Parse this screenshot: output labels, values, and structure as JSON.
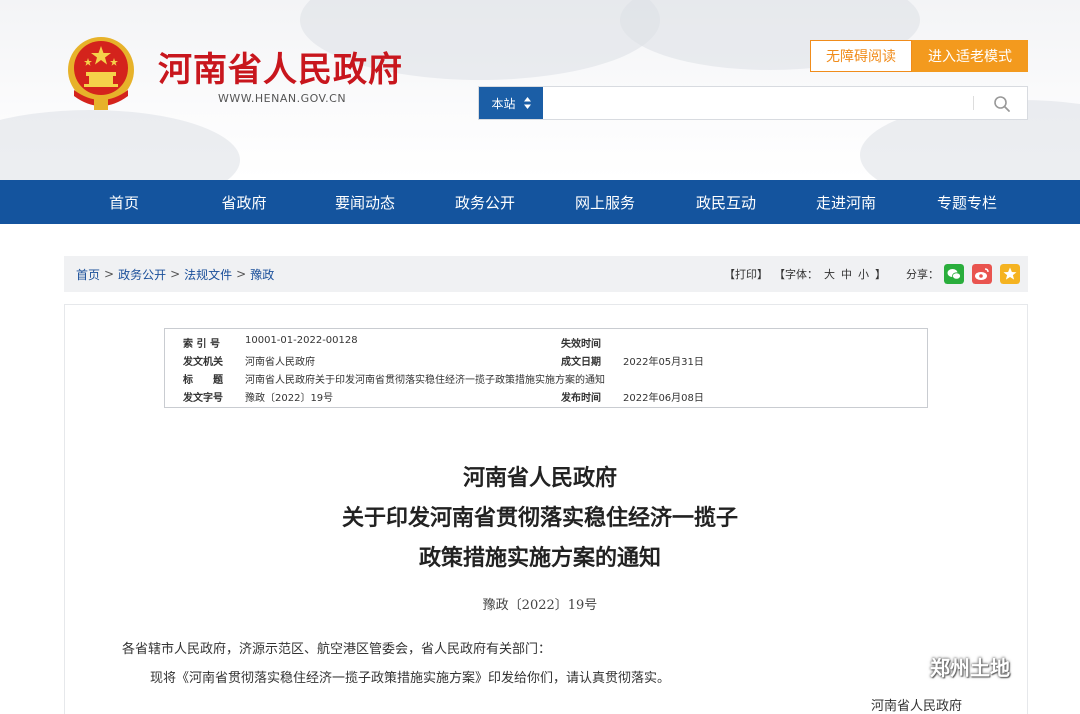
{
  "header": {
    "site_title": "河南省人民政府",
    "site_url": "WWW.HENAN.GOV.CN",
    "accessibility_label": "无障碍阅读",
    "elder_mode_label": "进入适老模式",
    "search_scope": "本站",
    "search_value": ""
  },
  "nav": {
    "items": [
      "首页",
      "省政府",
      "要闻动态",
      "政务公开",
      "网上服务",
      "政民互动",
      "走进河南",
      "专题专栏"
    ]
  },
  "breadcrumb": {
    "items": [
      "首页",
      "政务公开",
      "法规文件",
      "豫政"
    ],
    "separator": ">"
  },
  "tools": {
    "print": "【打印】",
    "font_label": "【字体：",
    "font_large": "大",
    "font_medium": "中",
    "font_small": "小",
    "font_end": "】",
    "share_label": "分享："
  },
  "meta": {
    "index_key": "索 引 号",
    "index_val": "10001-01-2022-00128",
    "expire_key": "失效时间",
    "expire_val": "",
    "issuer_key": "发文机关",
    "issuer_val": "河南省人民政府",
    "created_key": "成文日期",
    "created_val": "2022年05月31日",
    "title_key": "标　　题",
    "title_val": "河南省人民政府关于印发河南省贯彻落实稳住经济一揽子政策措施实施方案的通知",
    "docno_key": "发文字号",
    "docno_val": "豫政〔2022〕19号",
    "publish_key": "发布时间",
    "publish_val": "2022年06月08日"
  },
  "document": {
    "title_line1": "河南省人民政府",
    "title_line2": "关于印发河南省贯彻落实稳住经济一揽子",
    "title_line3": "政策措施实施方案的通知",
    "doc_number": "豫政〔2022〕19号",
    "salutation": "各省辖市人民政府，济源示范区、航空港区管委会，省人民政府有关部门：",
    "paragraph1": "现将《河南省贯彻落实稳住经济一揽子政策措施实施方案》印发给你们，请认真贯彻落实。",
    "signature": "河南省人民政府"
  },
  "watermark": {
    "text": "郑州土地"
  },
  "colors": {
    "brand_red": "#c8161d",
    "nav_blue": "#14549e",
    "accent_orange": "#f39a1e"
  }
}
